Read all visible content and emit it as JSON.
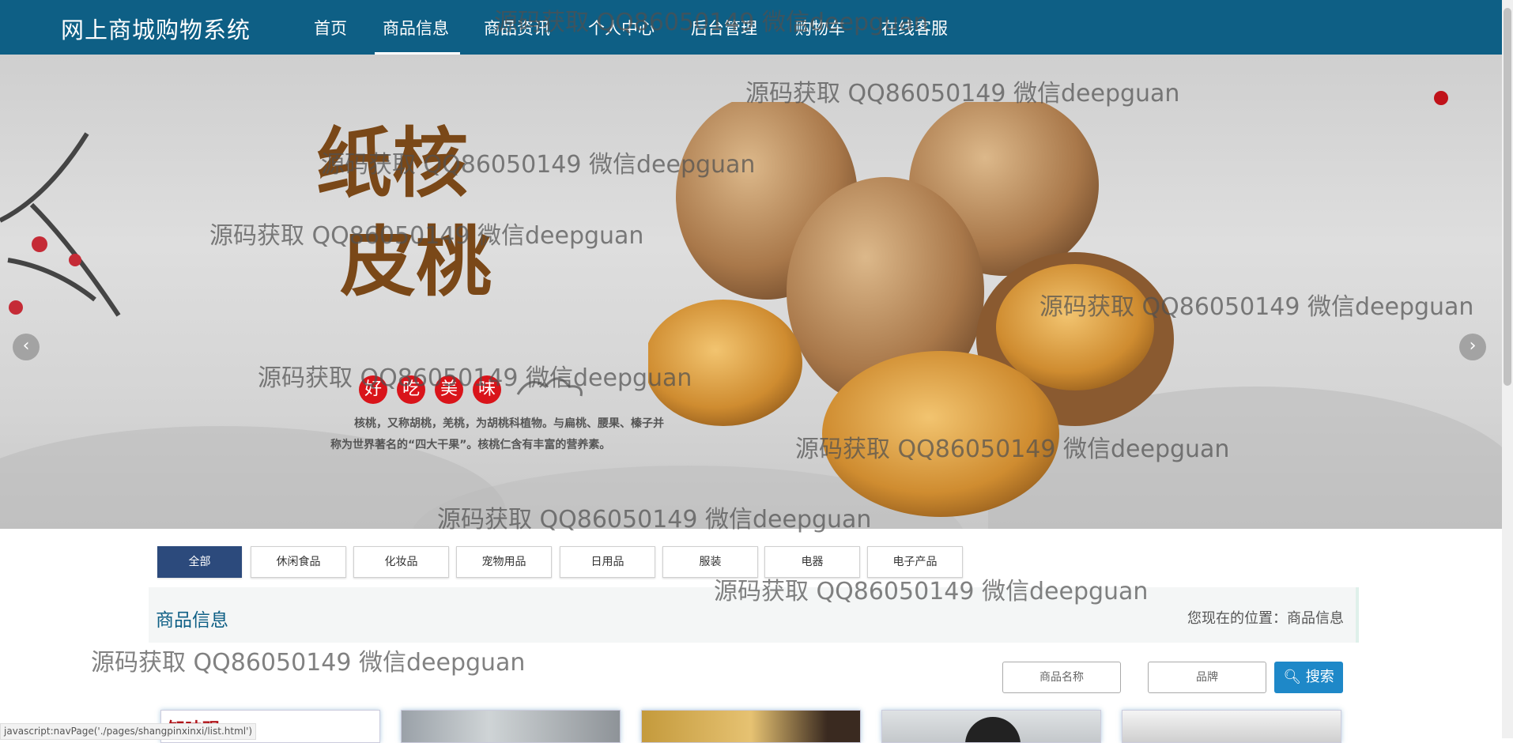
{
  "nav": {
    "brand": "网上商城购物系统",
    "items": [
      "首页",
      "商品信息",
      "商品资讯",
      "个人中心",
      "后台管理",
      "购物车",
      "在线客服"
    ],
    "active": "商品信息"
  },
  "banner": {
    "headline_1": "纸核",
    "headline_2": "皮桃",
    "badges": [
      "好",
      "吃",
      "美",
      "味"
    ],
    "desc_line1": "核桃，又称胡桃，羌桃，为胡桃科植物。与扁桃、腰果、榛子并",
    "desc_line2": "称为世界著名的“四大干果”。核桃仁含有丰富的营养素。",
    "prev_icon": "‹",
    "next_icon": "›"
  },
  "categories": [
    "全部",
    "休闲食品",
    "化妆品",
    "宠物用品",
    "日用品",
    "服装",
    "电器",
    "电子产品"
  ],
  "active_category": "全部",
  "section": {
    "title": "商品信息",
    "breadcrumb": "您现在的位置：商品信息"
  },
  "search": {
    "name_placeholder": "商品名称",
    "brand_placeholder": "品牌",
    "button_label": "搜索"
  },
  "product_cards": [
    {
      "label": "知味观"
    },
    {
      "label": ""
    },
    {
      "label": ""
    },
    {
      "label": ""
    },
    {
      "label": ""
    }
  ],
  "status_bar": "javascript:navPage('./pages/shangpinxinxi/list.html')",
  "watermark": "源码获取 QQ86050149 微信deepguan",
  "colors": {
    "navbar": "#0e5f85",
    "active_category": "#2c4a7c",
    "search_button": "#1e88c8"
  }
}
